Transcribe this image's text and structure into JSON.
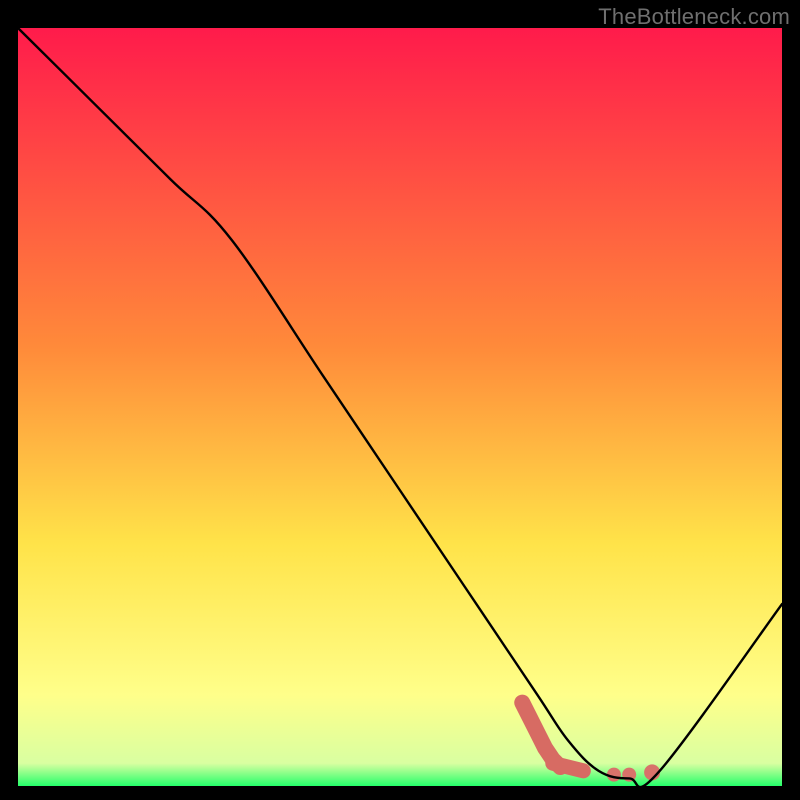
{
  "watermark": "TheBottleneck.com",
  "colors": {
    "gradient_top": "#ff1b4b",
    "gradient_yellow_mid": "#ffe349",
    "gradient_yellow_light": "#ffff8a",
    "gradient_green": "#25ff6a",
    "curve": "#000000",
    "marker_fill": "#d76b63",
    "marker_fill2": "#d8726a"
  },
  "chart_data": {
    "type": "line",
    "title": "",
    "xlabel": "",
    "ylabel": "",
    "xlim": [
      0,
      100
    ],
    "ylim": [
      0,
      100
    ],
    "series": [
      {
        "name": "bottleneck-curve",
        "x": [
          0,
          10,
          20,
          28,
          40,
          50,
          60,
          68,
          72,
          76,
          80,
          84,
          100
        ],
        "y": [
          100,
          90,
          80,
          72,
          54,
          39,
          24,
          12,
          6,
          2,
          1,
          2,
          24
        ]
      }
    ],
    "markers": {
      "name": "highlighted-range",
      "points": [
        {
          "x": 66,
          "y": 11
        },
        {
          "x": 67,
          "y": 9
        },
        {
          "x": 68,
          "y": 7
        },
        {
          "x": 69,
          "y": 5
        },
        {
          "x": 70,
          "y": 3.5
        },
        {
          "x": 71,
          "y": 2.5
        },
        {
          "x": 73,
          "y": 2
        },
        {
          "x": 75,
          "y": 1.8
        },
        {
          "x": 78,
          "y": 1.5
        },
        {
          "x": 80,
          "y": 1.5
        },
        {
          "x": 83,
          "y": 1.8
        }
      ]
    }
  }
}
